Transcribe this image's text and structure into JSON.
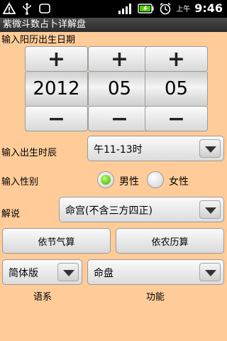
{
  "statusbar": {
    "icons": [
      "warning-icon",
      "usb-icon",
      "sd-card-icon",
      "signal-icon",
      "battery-icon",
      "alarm-icon"
    ],
    "ampm": "上午",
    "time": "9:46"
  },
  "title": "紫微斗数占卜详解盘",
  "birth_date": {
    "label": "输入阳历出生日期",
    "plus": "+",
    "minus": "−",
    "year": "2012",
    "month": "05",
    "day": "05"
  },
  "birth_hour": {
    "label": "输入出生时辰",
    "selected": "午11-13时"
  },
  "gender": {
    "label": "输入性别",
    "options": [
      "男性",
      "女性"
    ],
    "selected": "男性",
    "accent": "#3fa800"
  },
  "explain": {
    "label": "解说",
    "selected": "命宫(不含三方四正)"
  },
  "buttons": {
    "jieqi": "依节气算",
    "nongli": "依农历算"
  },
  "language": {
    "selected": "简体版",
    "caption": "语系"
  },
  "function": {
    "selected": "命盘",
    "caption": "功能"
  },
  "colors": {
    "background": "#FFCC99",
    "titlebar": "#2b2b2b"
  }
}
